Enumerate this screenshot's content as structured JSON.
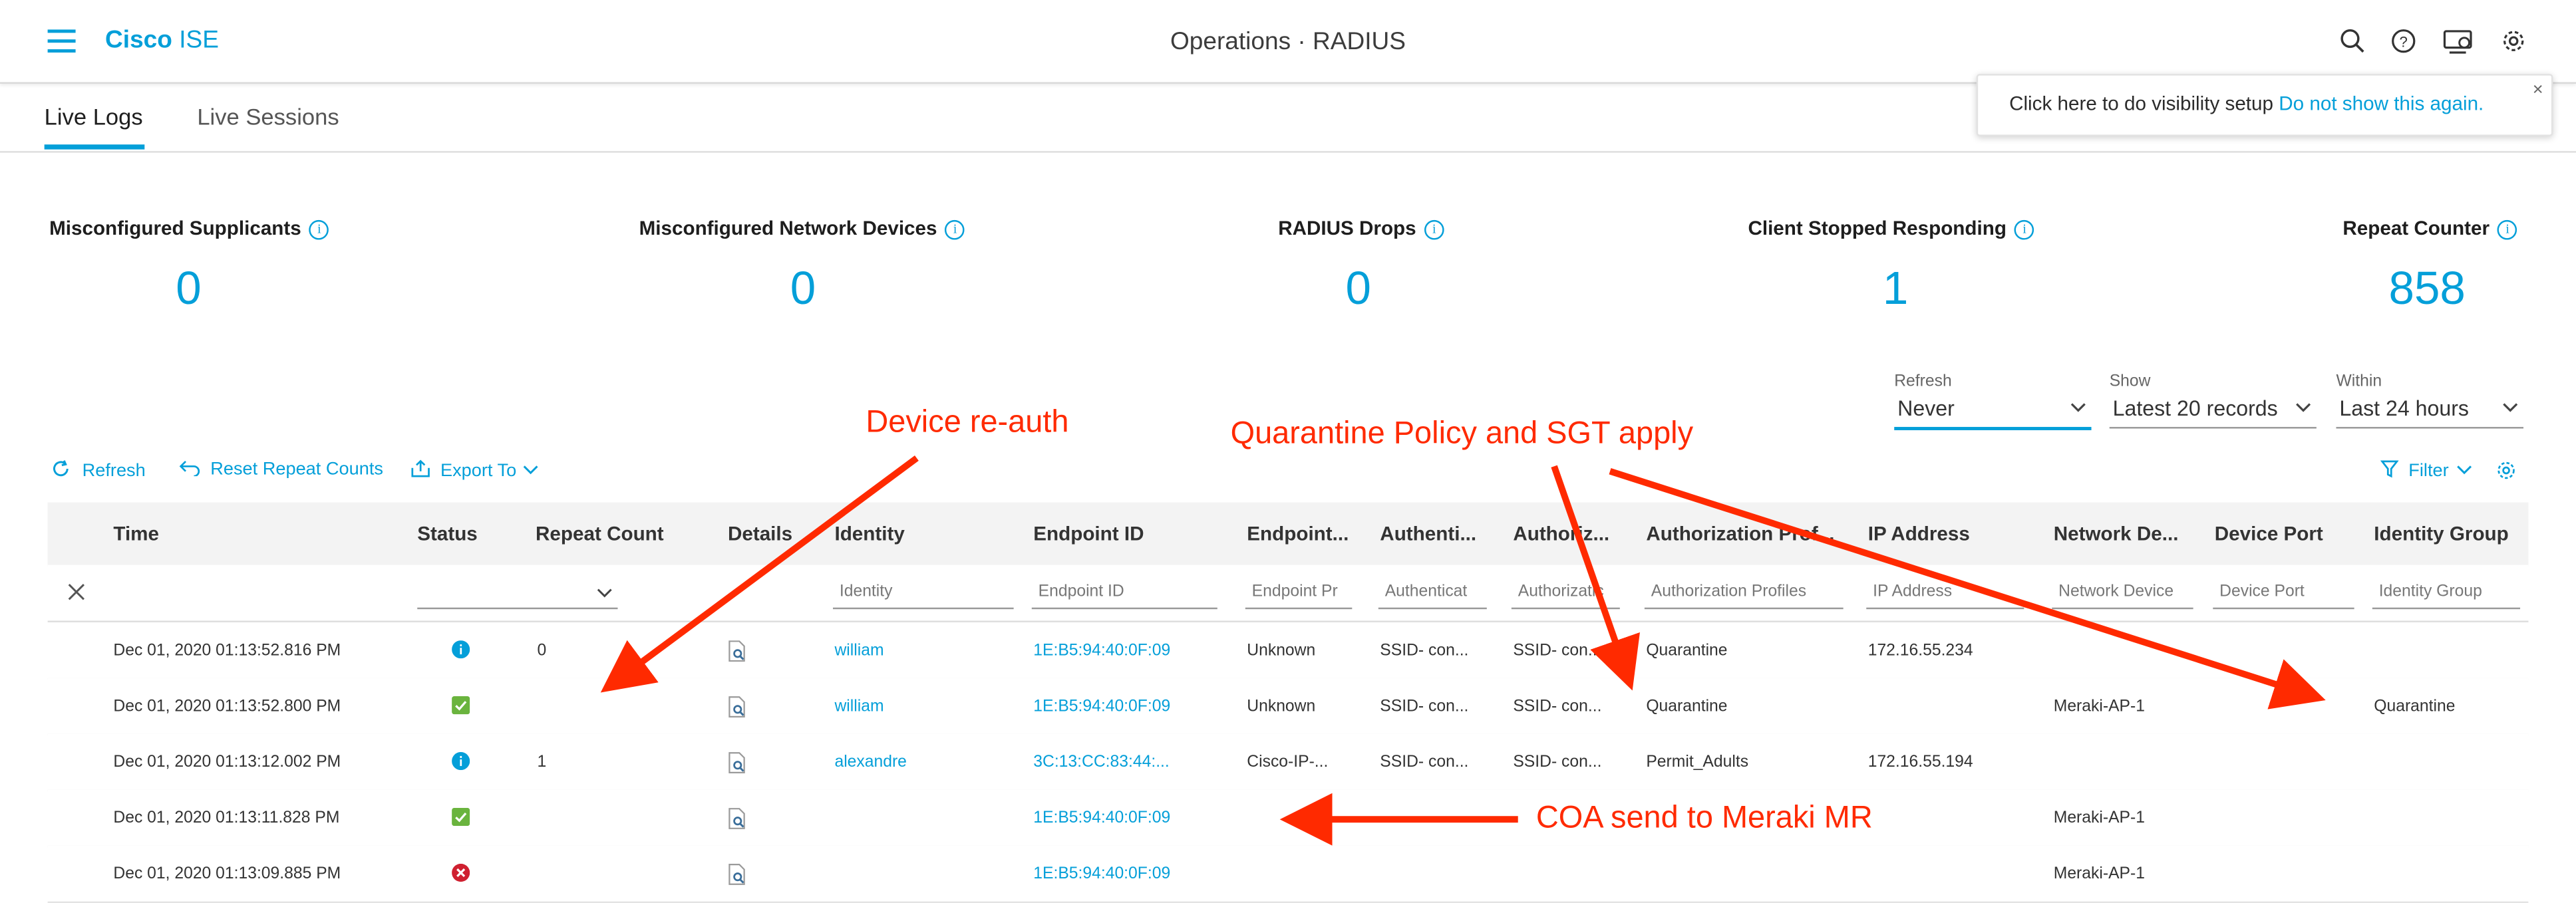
{
  "header": {
    "brand_bold": "Cisco",
    "brand_rest": "ISE",
    "title": "Operations · RADIUS",
    "icons": [
      "menu-icon",
      "search-icon",
      "help-icon",
      "visibility-setup-icon",
      "settings-icon"
    ]
  },
  "tabs": [
    {
      "label": "Live Logs",
      "active": true
    },
    {
      "label": "Live Sessions",
      "active": false
    }
  ],
  "banner": {
    "text": "Click here to do visibility setup",
    "link": "Do not show this again.",
    "close": "×"
  },
  "metrics": [
    {
      "label": "Misconfigured Supplicants",
      "value": "0"
    },
    {
      "label": "Misconfigured Network Devices",
      "value": "0"
    },
    {
      "label": "RADIUS Drops",
      "value": "0"
    },
    {
      "label": "Client Stopped Responding",
      "value": "1"
    },
    {
      "label": "Repeat Counter",
      "value": "858"
    }
  ],
  "controls": {
    "refresh": {
      "label": "Refresh",
      "value": "Never"
    },
    "show": {
      "label": "Show",
      "value": "Latest 20 records"
    },
    "within": {
      "label": "Within",
      "value": "Last 24 hours"
    }
  },
  "toolbar": {
    "refresh": "Refresh",
    "reset": "Reset Repeat Counts",
    "export": "Export To",
    "filter": "Filter"
  },
  "table": {
    "columns": [
      "Time",
      "Status",
      "Repeat Count",
      "Details",
      "Identity",
      "Endpoint ID",
      "Endpoint...",
      "Authenti...",
      "Authoriz...",
      "Authorization Prof...",
      "IP Address",
      "Network De...",
      "Device Port",
      "Identity Group"
    ],
    "filters": {
      "identity": "Identity",
      "endpoint_id": "Endpoint ID",
      "endpoint_profile": "Endpoint Pr",
      "authentication": "Authenticat",
      "authorization": "Authorizatic",
      "authorization_profiles": "Authorization Profiles",
      "ip_address": "IP Address",
      "network_device": "Network Device",
      "device_port": "Device Port",
      "identity_group": "Identity Group"
    },
    "rows": [
      {
        "time": "Dec 01, 2020 01:13:52.816 PM",
        "status": "info",
        "repeat": "0",
        "identity": "william",
        "endpoint_id": "1E:B5:94:40:0F:09",
        "endpoint_profile": "Unknown",
        "authn": "SSID- con...",
        "authz": "SSID- con...",
        "authz_profile": "Quarantine",
        "ip": "172.16.55.234",
        "network_device": "",
        "device_port": "",
        "identity_group": ""
      },
      {
        "time": "Dec 01, 2020 01:13:52.800 PM",
        "status": "success",
        "repeat": "",
        "identity": "william",
        "endpoint_id": "1E:B5:94:40:0F:09",
        "endpoint_profile": "Unknown",
        "authn": "SSID- con...",
        "authz": "SSID- con...",
        "authz_profile": "Quarantine",
        "ip": "",
        "network_device": "Meraki-AP-1",
        "device_port": "",
        "identity_group": "Quarantine"
      },
      {
        "time": "Dec 01, 2020 01:13:12.002 PM",
        "status": "info",
        "repeat": "1",
        "identity": "alexandre",
        "endpoint_id": "3C:13:CC:83:44:...",
        "endpoint_profile": "Cisco-IP-...",
        "authn": "SSID- con...",
        "authz": "SSID- con...",
        "authz_profile": "Permit_Adults",
        "ip": "172.16.55.194",
        "network_device": "",
        "device_port": "",
        "identity_group": ""
      },
      {
        "time": "Dec 01, 2020 01:13:11.828 PM",
        "status": "success",
        "repeat": "",
        "identity": "",
        "endpoint_id": "1E:B5:94:40:0F:09",
        "endpoint_profile": "",
        "authn": "",
        "authz": "",
        "authz_profile": "",
        "ip": "",
        "network_device": "Meraki-AP-1",
        "device_port": "",
        "identity_group": ""
      },
      {
        "time": "Dec 01, 2020 01:13:09.885 PM",
        "status": "fail",
        "repeat": "",
        "identity": "",
        "endpoint_id": "1E:B5:94:40:0F:09",
        "endpoint_profile": "",
        "authn": "",
        "authz": "",
        "authz_profile": "",
        "ip": "",
        "network_device": "Meraki-AP-1",
        "device_port": "",
        "identity_group": ""
      }
    ]
  },
  "annotations": {
    "device_reauth": "Device re-auth",
    "quarantine": "Quarantine Policy and SGT apply",
    "coa": "COA send to Meraki MR"
  },
  "colors": {
    "accent": "#049fd9",
    "annotation": "#ff2a00",
    "success": "#6ab43e",
    "info": "#049fd9",
    "fail": "#cf2030"
  }
}
